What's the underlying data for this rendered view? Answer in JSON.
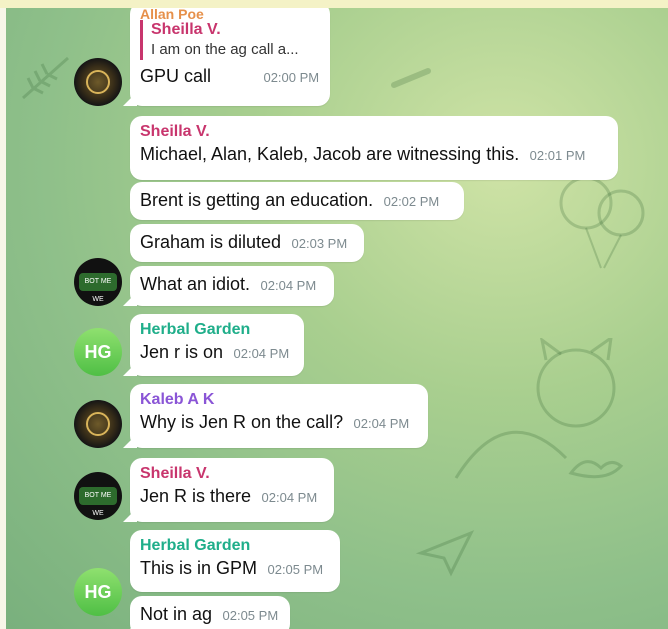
{
  "colors": {
    "sheilla": "#c8356d",
    "herbal": "#1fae8a",
    "kaleb": "#8a55d6",
    "allan": "#e6904a",
    "time": "#7d8a8f"
  },
  "messages": [
    {
      "sender": "Allan Poe",
      "quote_name": "Sheilla V.",
      "quote_text": "I am on the ag call a...",
      "text": "GPU call",
      "time": "02:00 PM"
    },
    {
      "sender": "Sheilla V.",
      "text": "Michael, Alan, Kaleb, Jacob are witnessing this.",
      "time": "02:01 PM"
    },
    {
      "text": "Brent is getting an education.",
      "time": "02:02 PM"
    },
    {
      "text": "Graham is diluted",
      "time": "02:03 PM"
    },
    {
      "text": "What an idiot.",
      "time": "02:04 PM"
    },
    {
      "sender": "Herbal Garden",
      "text": "Jen r is on",
      "time": "02:04 PM",
      "avatar": "HG"
    },
    {
      "sender": "Kaleb A K",
      "text": "Why is Jen R on the call?",
      "time": "02:04 PM"
    },
    {
      "sender": "Sheilla V.",
      "text": "Jen R is there",
      "time": "02:04 PM"
    },
    {
      "sender": "Herbal Garden",
      "text": "This is in GPM",
      "time": "02:05 PM",
      "avatar": "HG"
    },
    {
      "text": "Not in ag",
      "time": "02:05 PM"
    }
  ],
  "avatar_labels": {
    "bot_text": "BOT ME WE",
    "hg_initials": "HG"
  },
  "wallpaper_icons": [
    "fish-bone-icon",
    "bone-icon",
    "cat-icon",
    "balloon-icon",
    "bird-icon",
    "paper-plane-icon"
  ]
}
